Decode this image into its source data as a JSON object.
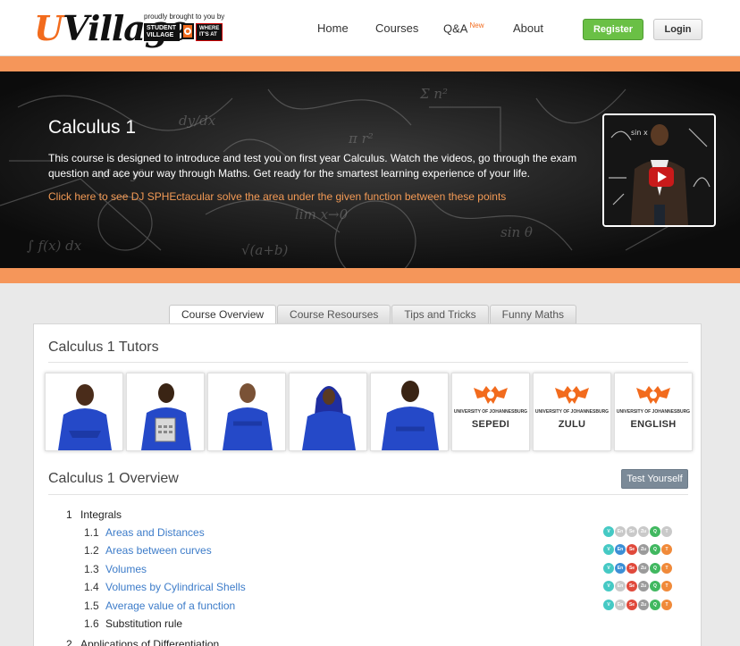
{
  "header": {
    "logo_u": "U",
    "logo_rest": "Village",
    "sponsor_text": "proudly brought to you by",
    "sponsor_badge": "STUDENT VILLAGE",
    "sponsor_where": "WHERE IT'S AT",
    "nav": {
      "home": "Home",
      "courses": "Courses",
      "qa": "Q&A",
      "qa_badge": "New",
      "about": "About"
    },
    "register": "Register",
    "login": "Login"
  },
  "hero": {
    "title": "Calculus 1",
    "description": "This course is designed to introduce and test you on first year Calculus. Watch the videos, go through the exam question and ace your way through Maths. Get ready for the smartest learning experience of your life.",
    "link": "Click here to see DJ SPHEctacular solve the area under the given function between these points"
  },
  "tabs": [
    "Course Overview",
    "Course Resourses",
    "Tips and Tricks",
    "Funny Maths"
  ],
  "tutors": {
    "title": "Calculus 1 Tutors",
    "uni_name": "UNIVERSITY OF JOHANNESBURG",
    "languages": [
      "SEPEDI",
      "ZULU",
      "ENGLISH"
    ]
  },
  "overview": {
    "title": "Calculus 1 Overview",
    "test_button": "Test Yourself",
    "chapters": [
      {
        "num": "1",
        "title": "Integrals",
        "lessons": [
          {
            "num": "1.1",
            "title": "Areas and Distances"
          },
          {
            "num": "1.2",
            "title": "Areas between curves"
          },
          {
            "num": "1.3",
            "title": "Volumes"
          },
          {
            "num": "1.4",
            "title": "Volumes by Cylindrical Shells"
          },
          {
            "num": "1.5",
            "title": "Average value of a function"
          },
          {
            "num": "1.6",
            "title": "Substitution rule"
          }
        ]
      },
      {
        "num": "2",
        "title": "Applications of Differentiation"
      }
    ],
    "badge_labels": [
      "V",
      "En",
      "Se",
      "Zu",
      "Q",
      "T"
    ]
  },
  "colors": {
    "accent_orange": "#f26b1d",
    "band_orange": "#f5965a",
    "register_green": "#6ac045",
    "link_blue": "#3d7cc9",
    "badge_v": "#45c9c4",
    "badge_en": "#3d8fd6",
    "badge_se": "#e04a3c",
    "badge_zu": "#9b9b9b",
    "badge_q": "#41b860",
    "badge_t": "#f08a3a",
    "badge_off": "#c9c9c9"
  }
}
